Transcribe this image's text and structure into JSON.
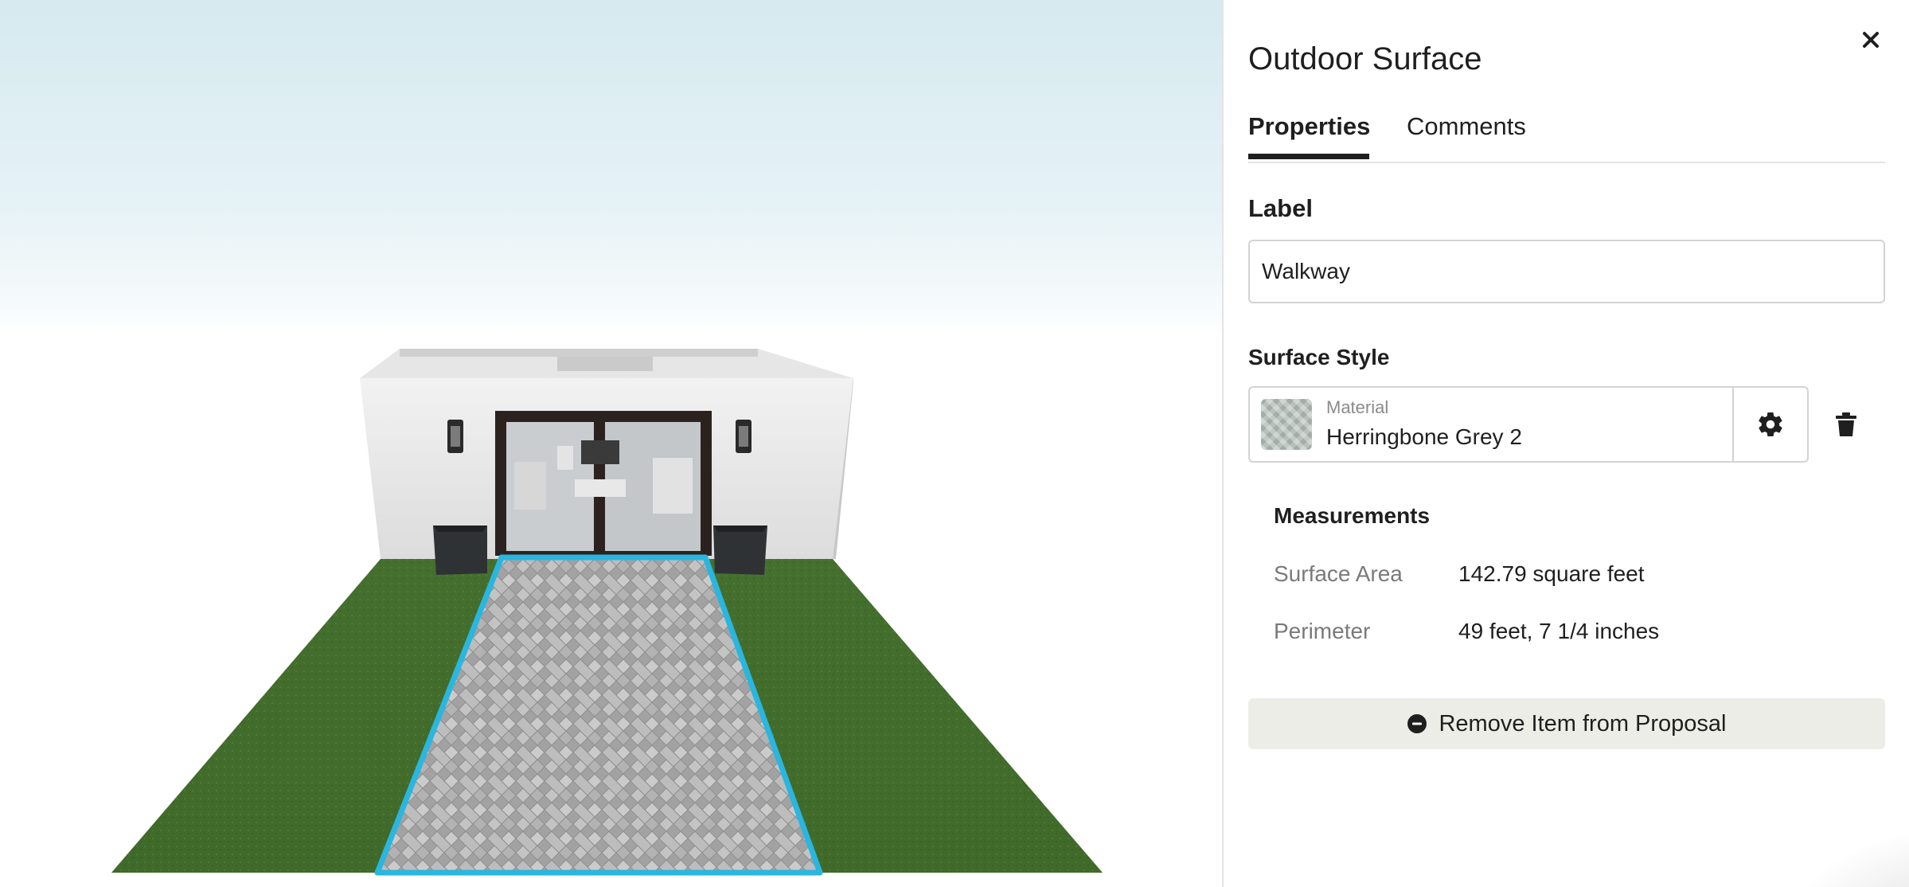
{
  "panel": {
    "title": "Outdoor Surface",
    "close_icon": "close-icon",
    "tabs": [
      {
        "label": "Properties",
        "active": true
      },
      {
        "label": "Comments",
        "active": false
      }
    ],
    "label_section": {
      "heading": "Label",
      "value": "Walkway"
    },
    "surface_style": {
      "heading": "Surface Style",
      "material_caption": "Material",
      "material_name": "Herringbone Grey 2",
      "gear_icon": "gear-icon",
      "trash_icon": "trash-icon"
    },
    "measurements": {
      "heading": "Measurements",
      "rows": [
        {
          "key": "Surface Area",
          "value": "142.79 square feet"
        },
        {
          "key": "Perimeter",
          "value": "49 feet, 7 1/4 inches"
        }
      ]
    },
    "remove_button": {
      "label": "Remove Item from Proposal",
      "icon": "minus-circle-icon"
    }
  },
  "viewport": {
    "scene": "3d-render",
    "selection_color": "#29b6e0",
    "grass_color": "#4d7a33",
    "paver_color": "#a9a9a9"
  }
}
